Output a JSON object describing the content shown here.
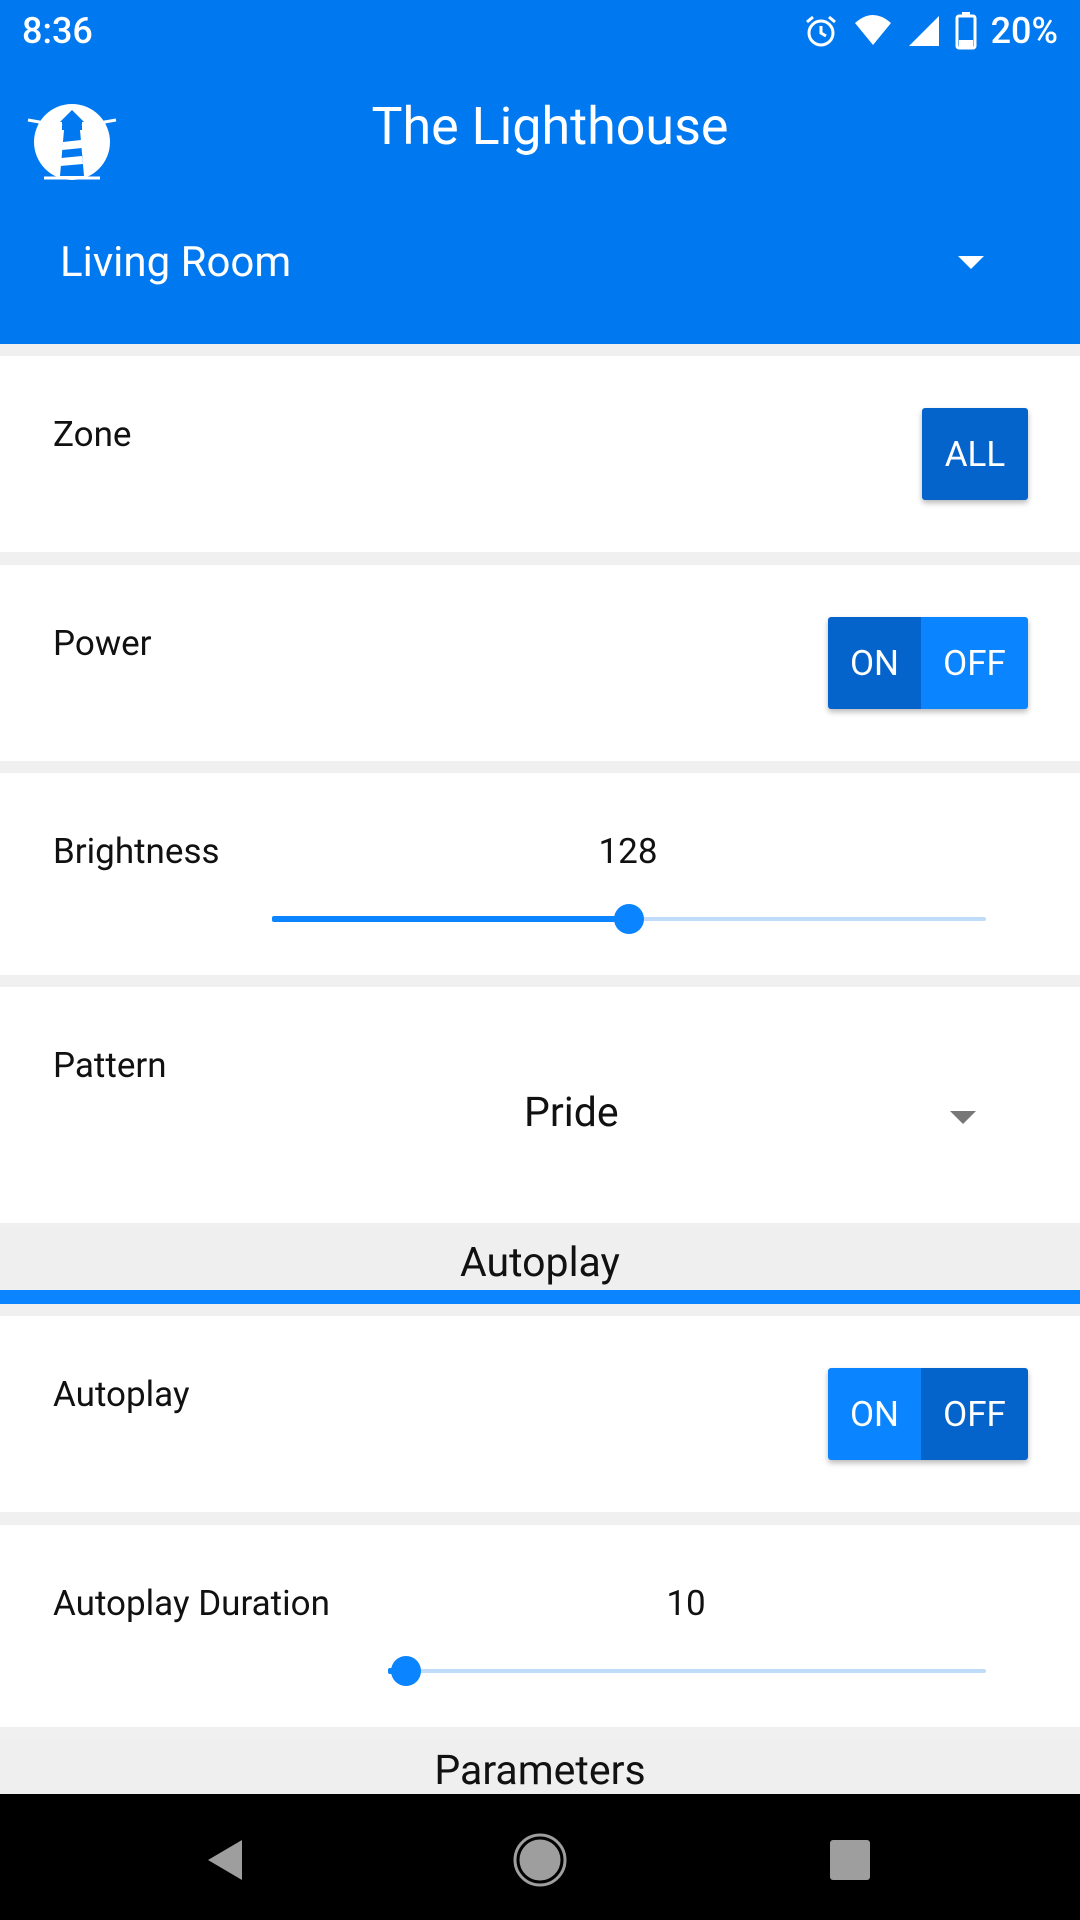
{
  "status_bar": {
    "time": "8:36",
    "battery_percent": "20%",
    "icons": [
      "alarm-icon",
      "wifi-icon",
      "signal-icon",
      "battery-icon"
    ]
  },
  "header": {
    "app_title": "The Lighthouse",
    "room_selected": "Living Room"
  },
  "zone": {
    "label": "Zone",
    "button": "ALL"
  },
  "power": {
    "label": "Power",
    "on": "ON",
    "off": "OFF",
    "active": "ON"
  },
  "brightness": {
    "label": "Brightness",
    "value": "128",
    "fraction": 0.5
  },
  "pattern": {
    "label": "Pattern",
    "selected": "Pride"
  },
  "autoplay_section": {
    "title": "Autoplay"
  },
  "autoplay": {
    "label": "Autoplay",
    "on": "ON",
    "off": "OFF",
    "active": "OFF"
  },
  "autoplay_duration": {
    "label": "Autoplay Duration",
    "value": "10",
    "fraction": 0.03
  },
  "parameters_section": {
    "title": "Parameters"
  },
  "colors": {
    "primary": "#0078f0",
    "button": "#0a84ff",
    "button_active": "#0564cc"
  }
}
